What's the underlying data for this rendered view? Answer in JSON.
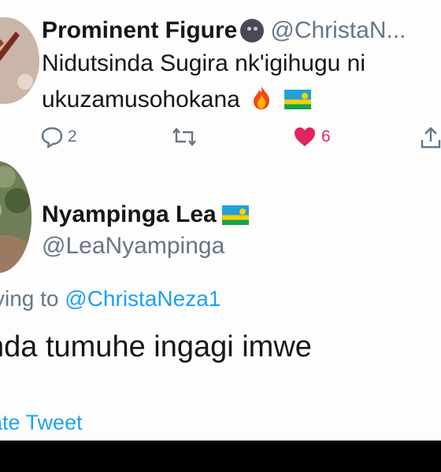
{
  "tweet1": {
    "display_name": "Prominent Figure",
    "handle": "@ChristaN...",
    "text_line1": "Nidutsinda Sugira nk'igihugu ni",
    "text_line2": "ukuzamusohokana",
    "replies": "2",
    "likes": "6",
    "icons": [
      "new-moon-face-emoji",
      "fire-emoji",
      "rwanda-flag-emoji",
      "reply-icon",
      "retweet-icon",
      "heart-icon",
      "share-icon"
    ]
  },
  "tweet2": {
    "display_name": "Nyampinga Lea",
    "handle": "@LeaNyampinga",
    "replying_prefix": "ying to",
    "replying_mention": "@ChristaNeza1",
    "text": "nda tumuhe ingagi imwe",
    "quote_link": "late Tweet",
    "icons": [
      "rwanda-flag-emoji"
    ]
  },
  "colors": {
    "text": "#14171a",
    "muted": "#657786",
    "accent": "#1da1f2",
    "like": "#e0245e"
  }
}
